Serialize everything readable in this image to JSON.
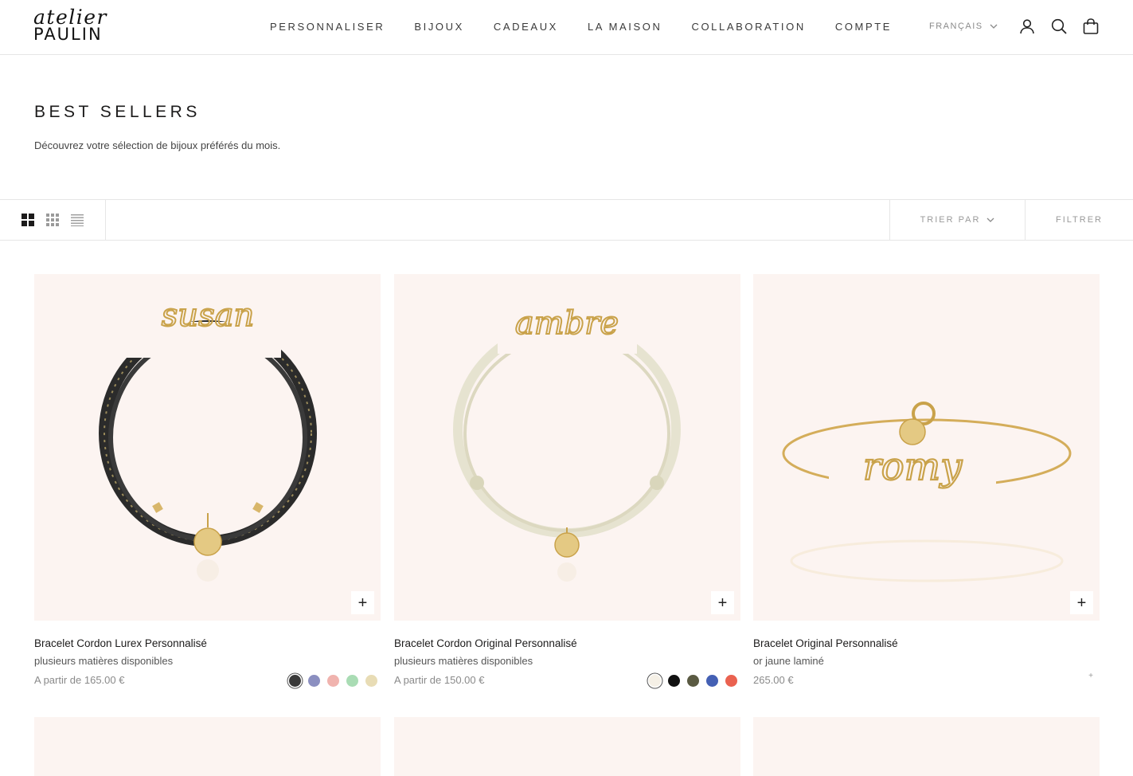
{
  "brand": {
    "line1": "atelier",
    "line2": "PAULIN"
  },
  "nav": [
    {
      "label": "PERSONNALISER"
    },
    {
      "label": "BIJOUX"
    },
    {
      "label": "CADEAUX"
    },
    {
      "label": "LA MAISON"
    },
    {
      "label": "COLLABORATION"
    },
    {
      "label": "COMPTE"
    }
  ],
  "header": {
    "language": "FRANÇAIS",
    "icons": [
      "account-icon",
      "search-icon",
      "cart-icon"
    ]
  },
  "page": {
    "title": "BEST SELLERS",
    "description": "Découvrez votre sélection de bijoux préférés du mois."
  },
  "toolbar": {
    "sort_label": "TRIER PAR",
    "filter_label": "FILTRER",
    "layout_icons": [
      "grid-large-icon",
      "grid-small-icon",
      "list-icon"
    ]
  },
  "products": [
    {
      "title": "Bracelet Cordon Lurex Personnalisé",
      "subtitle": "plusieurs matières disponibles",
      "price": "A partir de 165.00 €",
      "engraving": "susan",
      "swatches": [
        "#3a3a3a",
        "#8b8fc0",
        "#f0b3ae",
        "#a9dcb4",
        "#e8dcb5"
      ]
    },
    {
      "title": "Bracelet Cordon Original Personnalisé",
      "subtitle": "plusieurs matières disponibles",
      "price": "A partir de 150.00 €",
      "engraving": "ambre",
      "swatches": [
        "#f5f0e6",
        "#111111",
        "#5a5a42",
        "#4460b4",
        "#ea6250"
      ]
    },
    {
      "title": "Bracelet Original Personnalisé",
      "subtitle": "or jaune laminé",
      "price": "265.00 €",
      "engraving": "romy",
      "swatches": []
    }
  ],
  "colors": {
    "card_bg": "#fcf4f1",
    "gold": "#c9a24a",
    "border": "#e6e6e6"
  }
}
